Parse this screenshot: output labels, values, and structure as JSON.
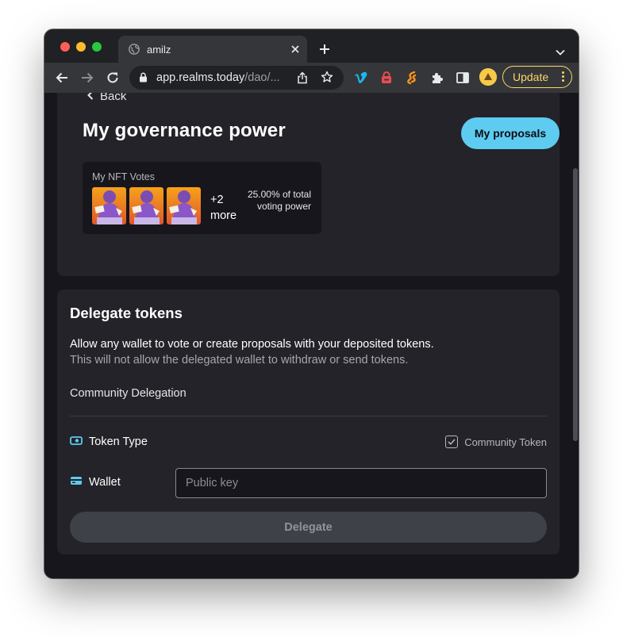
{
  "browser": {
    "tab": {
      "title": "amilz",
      "favicon": "globe-icon"
    },
    "url": {
      "host": "app.realms.today",
      "path": "/dao/..."
    },
    "update_label": "Update",
    "extensions": [
      "vimeo-icon",
      "bitwarden-icon",
      "solflare-icon",
      "puzzle-extensions-icon",
      "side-panel-icon"
    ]
  },
  "page": {
    "back_label": "Back",
    "title": "My governance power",
    "my_proposals_label": "My proposals",
    "nft": {
      "label": "My NFT Votes",
      "more_label": "+2 more",
      "voting_power": "25.00% of total voting power"
    },
    "delegate": {
      "title": "Delegate tokens",
      "desc_primary": "Allow any wallet to vote or create proposals with your deposited tokens.",
      "desc_secondary": "This will not allow the delegated wallet to withdraw or send tokens.",
      "community_delegation": "Community Delegation",
      "token_type_label": "Token Type",
      "community_token_label": "Community Token",
      "community_token_checked": true,
      "wallet_label": "Wallet",
      "wallet_placeholder": "Public key",
      "wallet_value": "",
      "delegate_button": "Delegate"
    }
  },
  "colors": {
    "accent": "#5ecbf0",
    "update": "#fdd663",
    "page_bg": "#17161c",
    "card_bg": "#242329",
    "button_disabled": "#3e4248"
  }
}
